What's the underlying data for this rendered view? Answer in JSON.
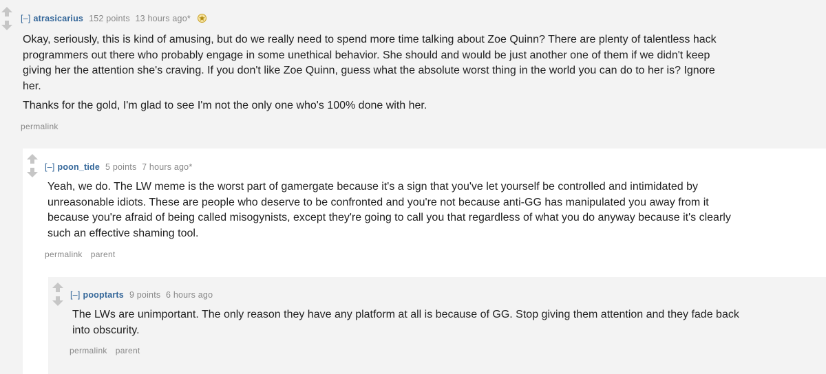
{
  "colors": {
    "page_background": "#f3f3f3",
    "nested_background": "#ffffff",
    "author_link": "#336699",
    "meta_text": "#888888",
    "body_text": "#222222",
    "vote_arrow": "#c6c6c6",
    "gilded_badge": "#d4a900"
  },
  "comments": [
    {
      "expand_label": "[–]",
      "author": "atrasicarius",
      "score": "152 points",
      "time": "13 hours ago*",
      "gilded_icon": "gold-star-icon",
      "paragraphs": [
        "Okay, seriously, this is kind of amusing, but do we really need to spend more time talking about Zoe Quinn? There are plenty of talentless hack programmers out there who probably engage in some unethical behavior. She should and would be just another one of them if we didn't keep giving her the attention she's craving. If you don't like Zoe Quinn, guess what the absolute worst thing in the world you can do to her is? Ignore her.",
        "Thanks for the gold, I'm glad to see I'm not the only one who's 100% done with her."
      ],
      "buttons": [
        "permalink"
      ]
    },
    {
      "expand_label": "[–]",
      "author": "poon_tide",
      "score": "5 points",
      "time": "7 hours ago*",
      "paragraphs": [
        "Yeah, we do. The LW meme is the worst part of gamergate because it's a sign that you've let yourself be controlled and intimidated by unreasonable idiots. These are people who deserve to be confronted and you're not because anti-GG has manipulated you away from it because you're afraid of being called misogynists, except they're going to call you that regardless of what you do anyway because it's clearly such an effective shaming tool."
      ],
      "buttons": [
        "permalink",
        "parent"
      ]
    },
    {
      "expand_label": "[–]",
      "author": "pooptarts",
      "score": "9 points",
      "time": "6 hours ago",
      "paragraphs": [
        "The LWs are unimportant. The only reason they have any platform at all is because of GG. Stop giving them attention and they fade back into obscurity."
      ],
      "buttons": [
        "permalink",
        "parent"
      ]
    }
  ]
}
